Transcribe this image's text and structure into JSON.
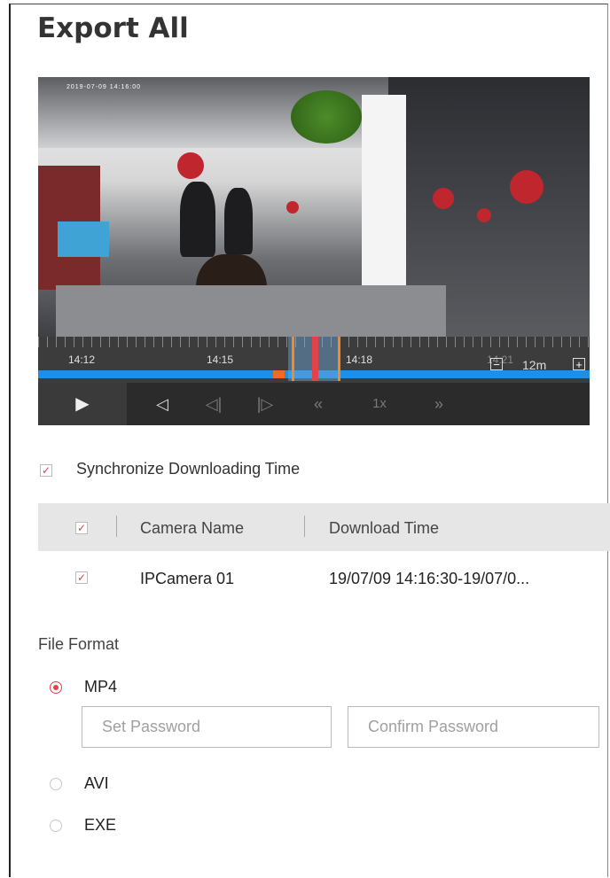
{
  "dialog": {
    "title": "Export All"
  },
  "player": {
    "osd_time": "2019-07-09 14:16:00",
    "timeline_labels": [
      "14:12",
      "14:15",
      "14:18",
      "14:21"
    ],
    "zoom_label": "12m",
    "speed_label": "1x",
    "colors": {
      "track": "#1e8fe3",
      "cursor": "#e2424a",
      "selection": "#f58a1f"
    }
  },
  "sync": {
    "label": "Synchronize Downloading Time",
    "checked": true
  },
  "table": {
    "headers": [
      "Camera Name",
      "Download Time"
    ],
    "rows": [
      {
        "camera": "IPCamera 01",
        "time": "19/07/09 14:16:30-19/07/0...",
        "checked": true
      }
    ]
  },
  "file_format": {
    "label": "File Format",
    "options": [
      {
        "label": "MP4",
        "selected": true
      },
      {
        "label": "AVI",
        "selected": false
      },
      {
        "label": "EXE",
        "selected": false
      }
    ],
    "set_password_placeholder": "Set Password",
    "confirm_password_placeholder": "Confirm Password"
  }
}
